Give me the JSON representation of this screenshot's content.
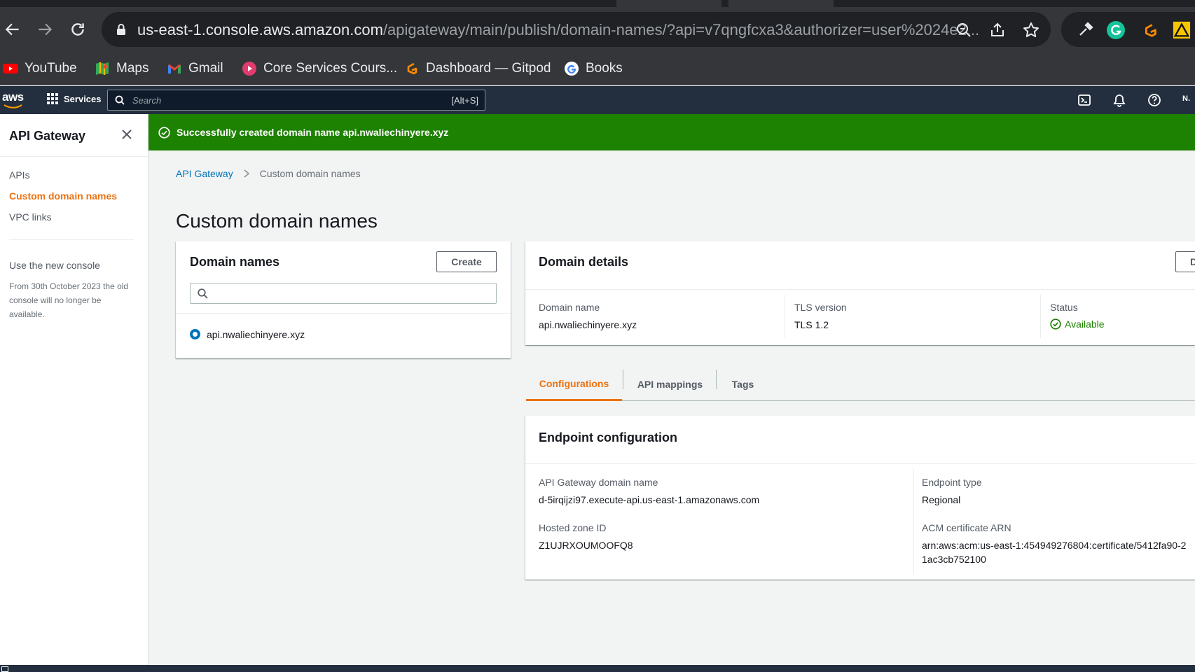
{
  "browser": {
    "url_host": "us-east-1.console.aws.amazon.com",
    "url_rest": "/apigateway/main/publish/domain-names/?api=v7qngfcxa3&authorizer=user%2024e2...",
    "bookmarks": [
      {
        "label": "YouTube",
        "icon": "youtube-icon"
      },
      {
        "label": "Maps",
        "icon": "maps-icon"
      },
      {
        "label": "Gmail",
        "icon": "gmail-icon"
      },
      {
        "label": "Core Services Cours...",
        "icon": "play-circle-icon"
      },
      {
        "label": "Dashboard — Gitpod",
        "icon": "gitpod-icon"
      },
      {
        "label": "Books",
        "icon": "google-icon"
      }
    ]
  },
  "aws_nav": {
    "logo": "aws",
    "services_label": "Services",
    "search_placeholder": "Search",
    "search_shortcut": "[Alt+S]",
    "user_label": "N."
  },
  "sidebar": {
    "title": "API Gateway",
    "items": [
      {
        "label": "APIs",
        "active": false
      },
      {
        "label": "Custom domain names",
        "active": true
      },
      {
        "label": "VPC links",
        "active": false
      }
    ],
    "new_console_label": "Use the new console",
    "note": "From 30th October 2023 the old console will no longer be available."
  },
  "flash": {
    "message": "Successfully created domain name api.nwaliechinyere.xyz",
    "color": "#1d8102"
  },
  "breadcrumb": {
    "root": "API Gateway",
    "current": "Custom domain names"
  },
  "page_title": "Custom domain names",
  "domain_list": {
    "title": "Domain names",
    "create_label": "Create",
    "filter_value": "",
    "items": [
      "api.nwaliechinyere.xyz"
    ]
  },
  "domain_details": {
    "title": "Domain details",
    "button_label": "D",
    "domain_name_label": "Domain name",
    "domain_name_value": "api.nwaliechinyere.xyz",
    "tls_label": "TLS version",
    "tls_value": "TLS 1.2",
    "status_label": "Status",
    "status_value": "Available"
  },
  "tabs": [
    {
      "label": "Configurations",
      "active": true
    },
    {
      "label": "API mappings",
      "active": false
    },
    {
      "label": "Tags",
      "active": false
    }
  ],
  "endpoint": {
    "title": "Endpoint configuration",
    "gw_domain_label": "API Gateway domain name",
    "gw_domain_value": "d-5irqijzi97.execute-api.us-east-1.amazonaws.com",
    "endpoint_type_label": "Endpoint type",
    "endpoint_type_value": "Regional",
    "zone_label": "Hosted zone ID",
    "zone_value": "Z1UJRXOUMOOFQ8",
    "acm_label": "ACM certificate ARN",
    "acm_value_line1": "arn:aws:acm:us-east-1:454949276804:certificate/5412fa90-2",
    "acm_value_line2": "1ac3cb752100"
  },
  "colors": {
    "accent": "#ec7211",
    "link": "#0073bb",
    "success": "#1d8102",
    "aws_nav": "#232f3e"
  }
}
